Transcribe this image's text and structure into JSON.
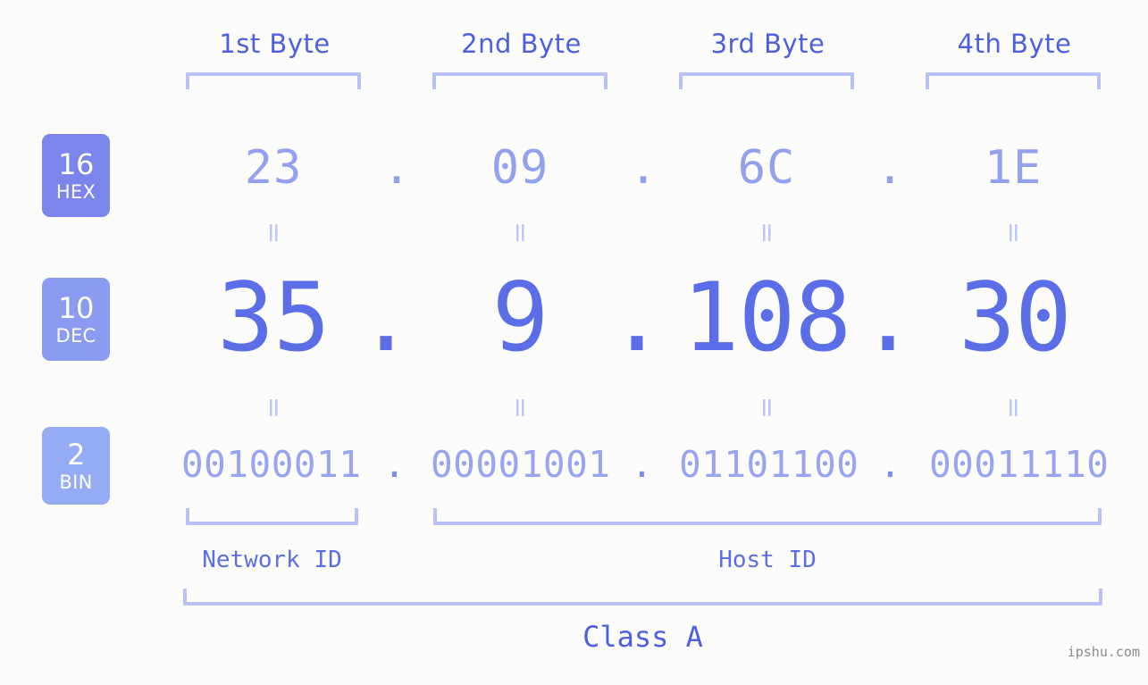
{
  "ip": {
    "address_dec": "35.9.108.30",
    "class": "Class A"
  },
  "header": {
    "byte_labels": [
      {
        "label": "1st Byte"
      },
      {
        "label": "2nd Byte"
      },
      {
        "label": "3rd Byte"
      },
      {
        "label": "4th Byte"
      }
    ]
  },
  "badges": [
    {
      "radix": "16",
      "name": "HEX",
      "color": "#7b85ec"
    },
    {
      "radix": "10",
      "name": "DEC",
      "color": "#8b9bf2"
    },
    {
      "radix": "2",
      "name": "BIN",
      "color": "#95abf4"
    }
  ],
  "rows": {
    "hex": {
      "values": [
        "23",
        "09",
        "6C",
        "1E"
      ],
      "separator": "."
    },
    "dec": {
      "values": [
        "35",
        "9",
        "108",
        "30"
      ],
      "separator": "."
    },
    "bin": {
      "values": [
        "00100011",
        "00001001",
        "01101100",
        "00011110"
      ],
      "separator": "."
    }
  },
  "equals_symbol": "=",
  "sections": {
    "network_id": "Network ID",
    "host_id": "Host ID",
    "class_label": "Class A"
  },
  "watermark": "ipshu.com",
  "colors": {
    "background": "#fcfdfa",
    "bracket": "#b9c2f7",
    "header_text": "#4b5fe0",
    "hex_text": "#92a0f0",
    "dec_text": "#5b6ee8",
    "bin_text": "#97a4f2",
    "equals": "#bcc6f8",
    "watermark": "#8a8a8a"
  }
}
